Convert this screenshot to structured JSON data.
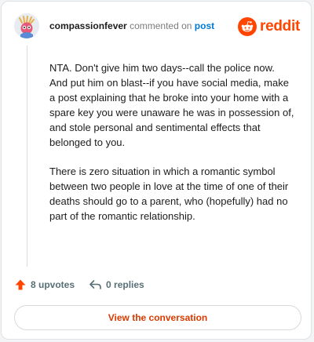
{
  "header": {
    "username": "compassionfever",
    "action_text": "commented on",
    "post_link": "post"
  },
  "brand": {
    "wordmark": "reddit",
    "logo_icon": "reddit-alien-icon",
    "color": "#ff4500"
  },
  "avatar": {
    "icon": "user-avatar-illustration"
  },
  "comment": {
    "paragraphs": [
      "NTA. Don't give him two days--call the police now. And put him on blast--if you have social media, make a post explaining that he broke into your home with a spare key you were unaware he was in possession of, and stole personal and sentimental effects that belonged to you.",
      "There is zero situation in which a romantic symbol between two people in love at the time of one of their deaths should go to a parent, who (hopefully) had no part of the romantic relationship."
    ]
  },
  "actions": {
    "upvotes_label": "8 upvotes",
    "replies_label": "0 replies",
    "upvote_icon": "upvote-arrow-icon",
    "reply_icon": "reply-arrow-icon",
    "upvote_color": "#ff4500"
  },
  "cta": {
    "label": "View the conversation"
  }
}
